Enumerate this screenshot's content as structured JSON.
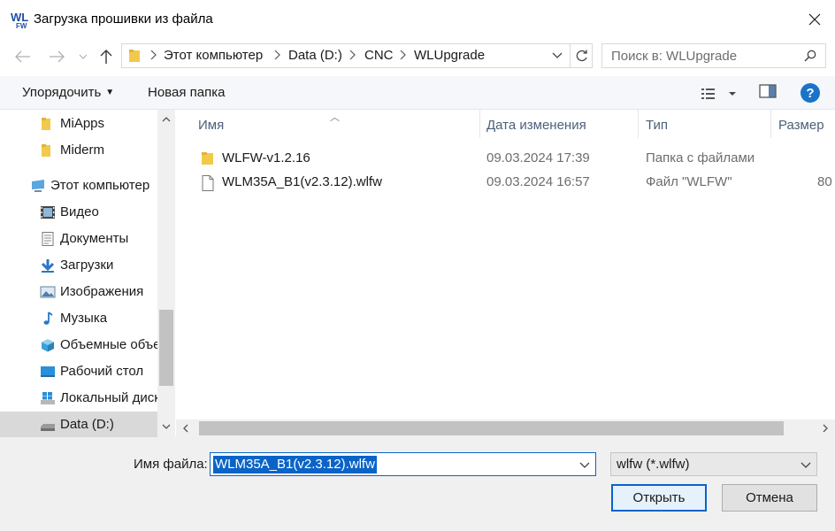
{
  "window": {
    "title": "Загрузка прошивки из файла",
    "logo_text": "WL"
  },
  "address_bar": {
    "crumbs": [
      "Этот компьютер",
      "Data (D:)",
      "CNC",
      "WLUpgrade"
    ]
  },
  "search": {
    "placeholder": "Поиск в: WLUpgrade"
  },
  "toolbar": {
    "organize_label": "Упорядочить",
    "new_folder_label": "Новая папка",
    "help_label": "?"
  },
  "sidebar": {
    "items": [
      {
        "label": "MiApps",
        "icon": "folder-icon"
      },
      {
        "label": "Miderm",
        "icon": "folder-icon"
      },
      {
        "label": "Этот компьютер",
        "icon": "computer-icon"
      },
      {
        "label": "Видео",
        "icon": "video-icon"
      },
      {
        "label": "Документы",
        "icon": "documents-icon"
      },
      {
        "label": "Загрузки",
        "icon": "downloads-icon"
      },
      {
        "label": "Изображения",
        "icon": "pictures-icon"
      },
      {
        "label": "Музыка",
        "icon": "music-icon"
      },
      {
        "label": "Объемные объекты",
        "icon": "3d-objects-icon"
      },
      {
        "label": "Рабочий стол",
        "icon": "desktop-icon"
      },
      {
        "label": "Локальный диск",
        "icon": "local-disk-icon"
      },
      {
        "label": "Data (D:)",
        "icon": "drive-icon"
      }
    ]
  },
  "columns": {
    "name": "Имя",
    "date": "Дата изменения",
    "type": "Тип",
    "size": "Размер"
  },
  "files": [
    {
      "name": "WLFW-v1.2.16",
      "date": "09.03.2024 17:39",
      "type": "Папка с файлами",
      "size": "",
      "icon": "folder-icon"
    },
    {
      "name": "WLM35A_B1(v2.3.12).wlfw",
      "date": "09.03.2024 16:57",
      "type": "Файл \"WLFW\"",
      "size": "80",
      "icon": "file-icon"
    }
  ],
  "bottom": {
    "filename_label": "Имя файла:",
    "filename_value": "WLM35A_B1(v2.3.12).wlfw",
    "filetype_value": "wlfw (*.wlfw)",
    "open_label": "Открыть",
    "cancel_label": "Отмена"
  },
  "colors": {
    "accent": "#0a64c8",
    "folder": "#f2c94c",
    "help": "#1a73c9"
  }
}
